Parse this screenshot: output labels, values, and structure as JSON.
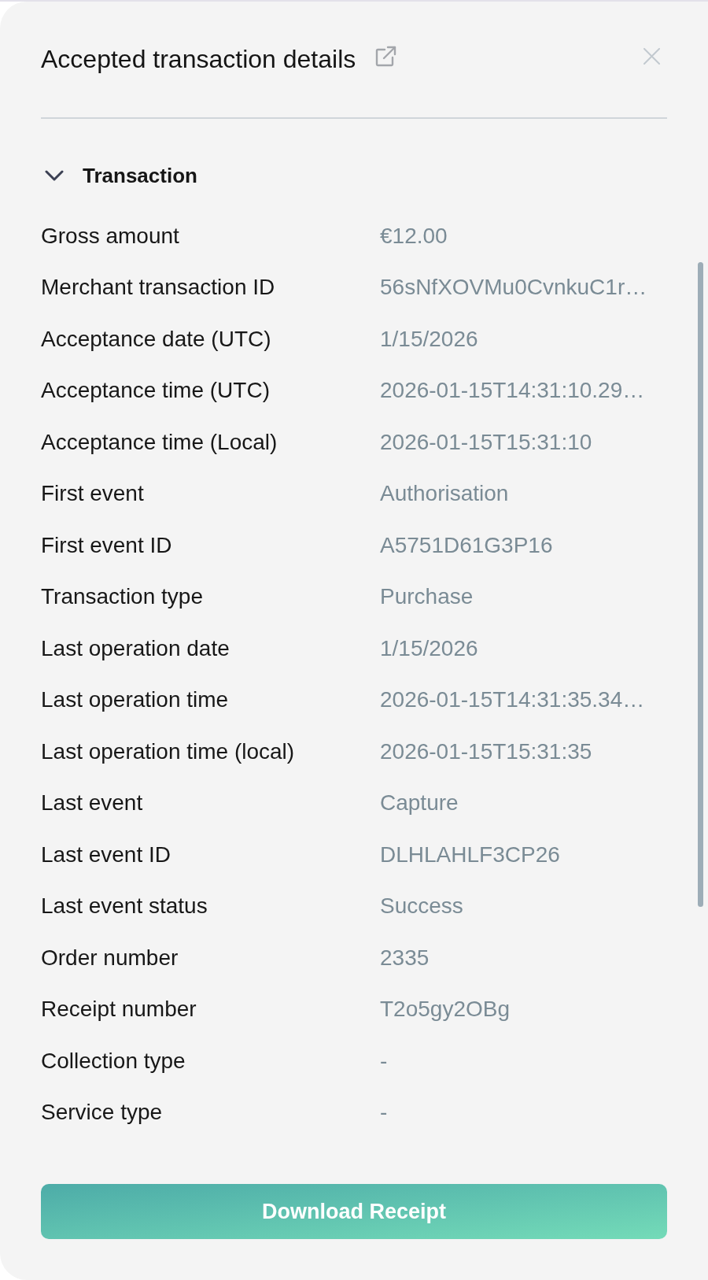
{
  "panel": {
    "title": "Accepted transaction details",
    "section": {
      "title": "Transaction",
      "expanded": true,
      "rows": [
        {
          "label": "Gross amount",
          "value": "€12.00"
        },
        {
          "label": "Merchant transaction ID",
          "value": "56sNfXOVMu0CvnkuC1r…"
        },
        {
          "label": "Acceptance date (UTC)",
          "value": "1/15/2026"
        },
        {
          "label": "Acceptance time (UTC)",
          "value": "2026-01-15T14:31:10.29…"
        },
        {
          "label": "Acceptance time (Local)",
          "value": "2026-01-15T15:31:10"
        },
        {
          "label": "First event",
          "value": "Authorisation"
        },
        {
          "label": "First event ID",
          "value": "A5751D61G3P16"
        },
        {
          "label": "Transaction type",
          "value": "Purchase"
        },
        {
          "label": "Last operation date",
          "value": "1/15/2026"
        },
        {
          "label": "Last operation time",
          "value": "2026-01-15T14:31:35.34…"
        },
        {
          "label": "Last operation time (local)",
          "value": "2026-01-15T15:31:35"
        },
        {
          "label": "Last event",
          "value": "Capture"
        },
        {
          "label": "Last event ID",
          "value": "DLHLAHLF3CP26"
        },
        {
          "label": "Last event status",
          "value": "Success"
        },
        {
          "label": "Order number",
          "value": "2335"
        },
        {
          "label": "Receipt number",
          "value": "T2o5gy2OBg"
        },
        {
          "label": "Collection type",
          "value": "-"
        },
        {
          "label": "Service type",
          "value": "-"
        }
      ]
    }
  },
  "button": {
    "label": "Download Receipt"
  }
}
